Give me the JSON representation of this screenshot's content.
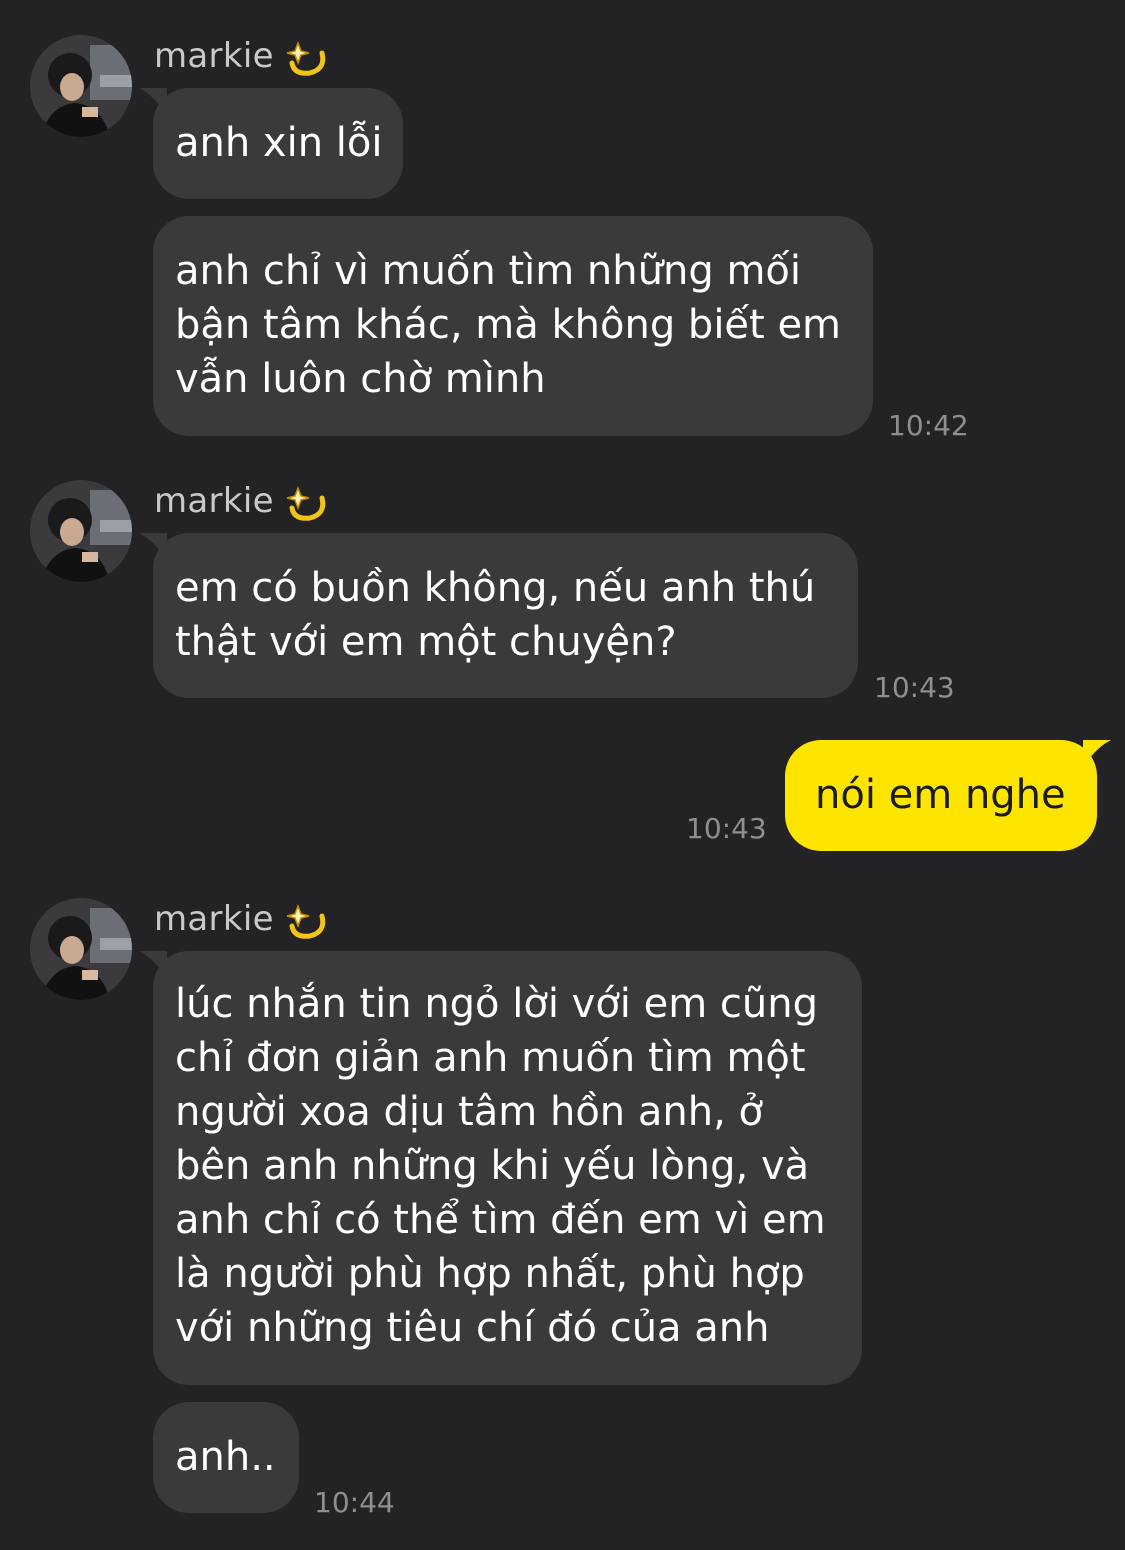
{
  "sender": {
    "name": "markie",
    "emoji_icon": "dizzy-sparkle-icon"
  },
  "colors": {
    "background": "#232325",
    "incoming_bubble": "#3a3a3d",
    "outgoing_bubble": "#fee500",
    "timestamp": "#8e8e93"
  },
  "messages": [
    {
      "from": "markie",
      "lines": [
        "anh xin lỗi"
      ]
    },
    {
      "from": "markie",
      "lines": [
        "anh chỉ vì muốn tìm những mối",
        "bận tâm khác, mà không biết em",
        "vẫn luôn chờ mình"
      ],
      "time": "10:42"
    },
    {
      "from": "markie",
      "lines": [
        "em có buồn không, nếu anh thú",
        "thật với em một chuyện?"
      ],
      "time": "10:43"
    },
    {
      "from": "me",
      "lines": [
        "nói em nghe"
      ],
      "time": "10:43"
    },
    {
      "from": "markie",
      "lines": [
        "lúc nhắn tin ngỏ lời với em cũng",
        "chỉ đơn giản anh muốn tìm một",
        "người xoa dịu tâm hồn anh, ở",
        "bên anh những khi yếu lòng, và",
        "anh chỉ có thể tìm đến em vì em",
        "là người phù hợp nhất, phù hợp",
        "với những tiêu chí đó của anh"
      ]
    },
    {
      "from": "markie",
      "lines": [
        "anh.."
      ],
      "time": "10:44"
    }
  ]
}
